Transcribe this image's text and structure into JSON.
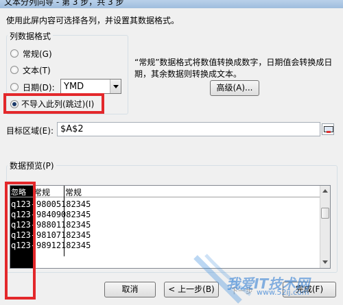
{
  "title": "文本分列向导 - 第 3 步，共 3 步",
  "instruction": "使用此屏内容可选择各列，并设置其数据格式。",
  "column_format": {
    "label": "列数据格式",
    "options": [
      {
        "label": "常规(G)",
        "selected": false
      },
      {
        "label": "文本(T)",
        "selected": false
      },
      {
        "label": "日期(D):",
        "selected": false
      },
      {
        "label": "不导入此列(跳过)(I)",
        "selected": true
      }
    ],
    "date_format_value": "YMD"
  },
  "description": [
    "“常规”数据格式将数值转换成数字，日期值会转换成日",
    "期，其余数据则转换成文本。"
  ],
  "advanced_button": "高级(A)...",
  "destination": {
    "label": "目标区域(E):",
    "value": "$A$2"
  },
  "preview": {
    "label": "数据预览(P)",
    "headers": [
      "忽略列",
      "常规",
      "常规"
    ],
    "rows": [
      [
        "q123-",
        "98005",
        "182345"
      ],
      [
        "q123-",
        "98409",
        "082345"
      ],
      [
        "q123-",
        "98801",
        "182345"
      ],
      [
        "q123-",
        "98107",
        "182345"
      ],
      [
        "q123-",
        "98912",
        "182345"
      ]
    ]
  },
  "buttons": {
    "cancel": "取消",
    "back": "< 上一步(B)",
    "finish": "完成(F)"
  },
  "watermark": {
    "text": "我爱IT技术网",
    "url": "www.52ij.com",
    "extra": "下一步"
  }
}
